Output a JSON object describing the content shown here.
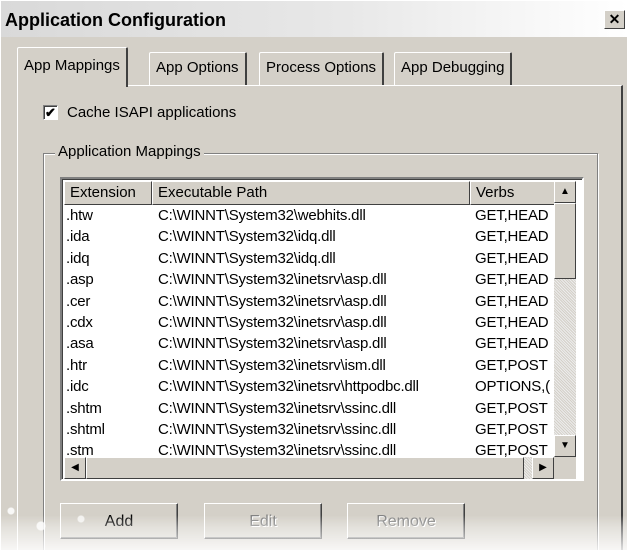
{
  "window": {
    "title": "Application Configuration",
    "close_glyph": "✕"
  },
  "tabs": [
    {
      "label": "App Mappings",
      "active": true
    },
    {
      "label": "App Options",
      "active": false
    },
    {
      "label": "Process Options",
      "active": false
    },
    {
      "label": "App Debugging",
      "active": false
    }
  ],
  "cache": {
    "label": "Cache ISAPI applications",
    "checked": true,
    "mark": "✔"
  },
  "group": {
    "title": "Application Mappings"
  },
  "columns": [
    "Extension",
    "Executable Path",
    "Verbs"
  ],
  "rows": [
    [
      ".htw",
      "C:\\WINNT\\System32\\webhits.dll",
      "GET,HEAD"
    ],
    [
      ".ida",
      "C:\\WINNT\\System32\\idq.dll",
      "GET,HEAD"
    ],
    [
      ".idq",
      "C:\\WINNT\\System32\\idq.dll",
      "GET,HEAD"
    ],
    [
      ".asp",
      "C:\\WINNT\\System32\\inetsrv\\asp.dll",
      "GET,HEAD"
    ],
    [
      ".cer",
      "C:\\WINNT\\System32\\inetsrv\\asp.dll",
      "GET,HEAD"
    ],
    [
      ".cdx",
      "C:\\WINNT\\System32\\inetsrv\\asp.dll",
      "GET,HEAD"
    ],
    [
      ".asa",
      "C:\\WINNT\\System32\\inetsrv\\asp.dll",
      "GET,HEAD"
    ],
    [
      ".htr",
      "C:\\WINNT\\System32\\inetsrv\\ism.dll",
      "GET,POST"
    ],
    [
      ".idc",
      "C:\\WINNT\\System32\\inetsrv\\httpodbc.dll",
      "OPTIONS,("
    ],
    [
      ".shtm",
      "C:\\WINNT\\System32\\inetsrv\\ssinc.dll",
      "GET,POST"
    ],
    [
      ".shtml",
      "C:\\WINNT\\System32\\inetsrv\\ssinc.dll",
      "GET,POST"
    ],
    [
      ".stm",
      "C:\\WINNT\\System32\\inetsrv\\ssinc.dll",
      "GET,POST"
    ]
  ],
  "scroll": {
    "up": "▲",
    "down": "▼",
    "left": "◀",
    "right": "▶"
  },
  "buttons": {
    "add": "Add",
    "edit": "Edit",
    "remove": "Remove"
  }
}
